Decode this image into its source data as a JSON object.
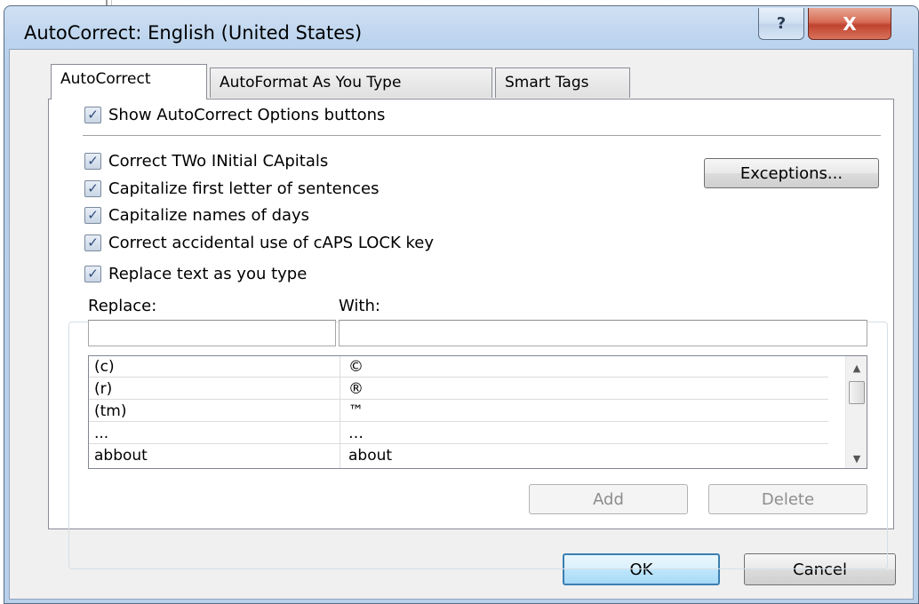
{
  "window": {
    "title": "AutoCorrect: English (United States)"
  },
  "titlebar": {
    "help": "?",
    "close": "X"
  },
  "tabs": [
    {
      "label": "AutoCorrect",
      "active": true
    },
    {
      "label": "AutoFormat As You Type",
      "active": false
    },
    {
      "label": "Smart Tags",
      "active": false
    }
  ],
  "options": {
    "show_buttons": "Show AutoCorrect Options buttons",
    "two_initial_caps": "Correct TWo INitial CApitals",
    "capitalize_sentences": "Capitalize first letter of sentences",
    "capitalize_days": "Capitalize names of days",
    "caps_lock": "Correct accidental use of cAPS LOCK key",
    "replace_text": "Replace text as you type"
  },
  "checked": true,
  "exceptions_label": "Exceptions...",
  "replace": {
    "replace_label": "Replace:",
    "with_label": "With:",
    "replace_value": "",
    "with_value": "",
    "entries": [
      {
        "replace": "(c)",
        "with": "©"
      },
      {
        "replace": "(r)",
        "with": "®"
      },
      {
        "replace": "(tm)",
        "with": "™"
      },
      {
        "replace": "...",
        "with": "…"
      },
      {
        "replace": "abbout",
        "with": "about"
      }
    ],
    "add_label": "Add",
    "delete_label": "Delete"
  },
  "footer": {
    "ok": "OK",
    "cancel": "Cancel"
  },
  "colors": {
    "title_bar": "#bcd4ee",
    "close_button": "#c8452f",
    "ok_border": "#3c7fb1"
  },
  "icons": {
    "checkbox": "check-mark",
    "scroll_up": "scroll-up-arrow",
    "scroll_down": "scroll-down-arrow"
  }
}
